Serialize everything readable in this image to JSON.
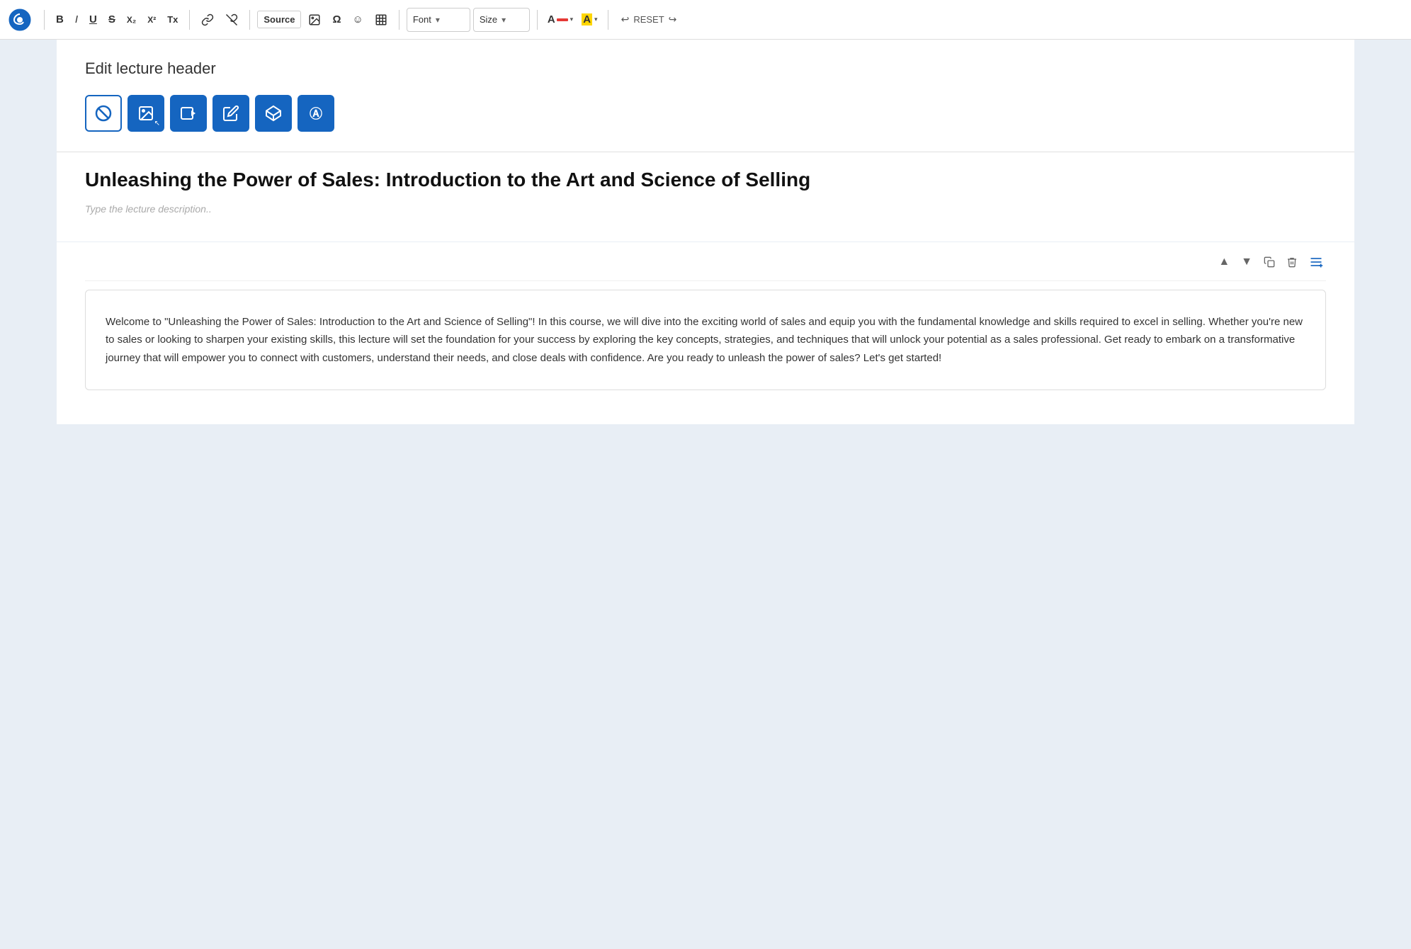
{
  "toolbar": {
    "logo_icon": "⚙",
    "bold_label": "B",
    "italic_label": "I",
    "underline_label": "U",
    "strikethrough_label": "S",
    "subscript_label": "X₂",
    "superscript_label": "X²",
    "clear_format_label": "Tx",
    "link_label": "🔗",
    "unlink_label": "🔗",
    "source_label": "Source",
    "image_label": "🖼",
    "special_char_label": "Ω",
    "emoji_label": "☺",
    "table_label": "▦",
    "font_label": "Font",
    "font_arrow": "▾",
    "size_label": "Size",
    "size_arrow": "▾",
    "font_color_label": "A",
    "highlight_label": "A",
    "reset_label": "RESET"
  },
  "lecture_header": {
    "section_title": "Edit lecture header",
    "icon_buttons": [
      {
        "name": "no-icon",
        "icon": "🚫",
        "outline": true
      },
      {
        "name": "image-icon",
        "icon": "🖼",
        "outline": false
      },
      {
        "name": "video-icon",
        "icon": "🎬",
        "outline": false
      },
      {
        "name": "edit-icon",
        "icon": "✏️",
        "outline": false
      },
      {
        "name": "ar-icon",
        "icon": "◈",
        "outline": false
      },
      {
        "name": "text-icon",
        "icon": "Ⓐ",
        "outline": false
      }
    ],
    "main_title": "Unleashing the Power of Sales: Introduction to the Art and Science of Selling",
    "description_placeholder": "Type the lecture description.."
  },
  "content_block": {
    "up_icon": "▲",
    "down_icon": "▼",
    "copy_icon": "⧉",
    "delete_icon": "🗑",
    "add_icon": "≡+",
    "body_text": "Welcome to \"Unleashing the Power of Sales: Introduction to the Art and Science of Selling\"! In this course, we will dive into the exciting world of sales and equip you with the fundamental knowledge and skills required to excel in selling. Whether you're new to sales or looking to sharpen your existing skills, this lecture will set the foundation for your success by exploring the key concepts, strategies, and techniques that will unlock your potential as a sales professional. Get ready to embark on a transformative journey that will empower you to connect with customers, understand their needs, and close deals with confidence. Are you ready to unleash the power of sales? Let's get started!"
  }
}
